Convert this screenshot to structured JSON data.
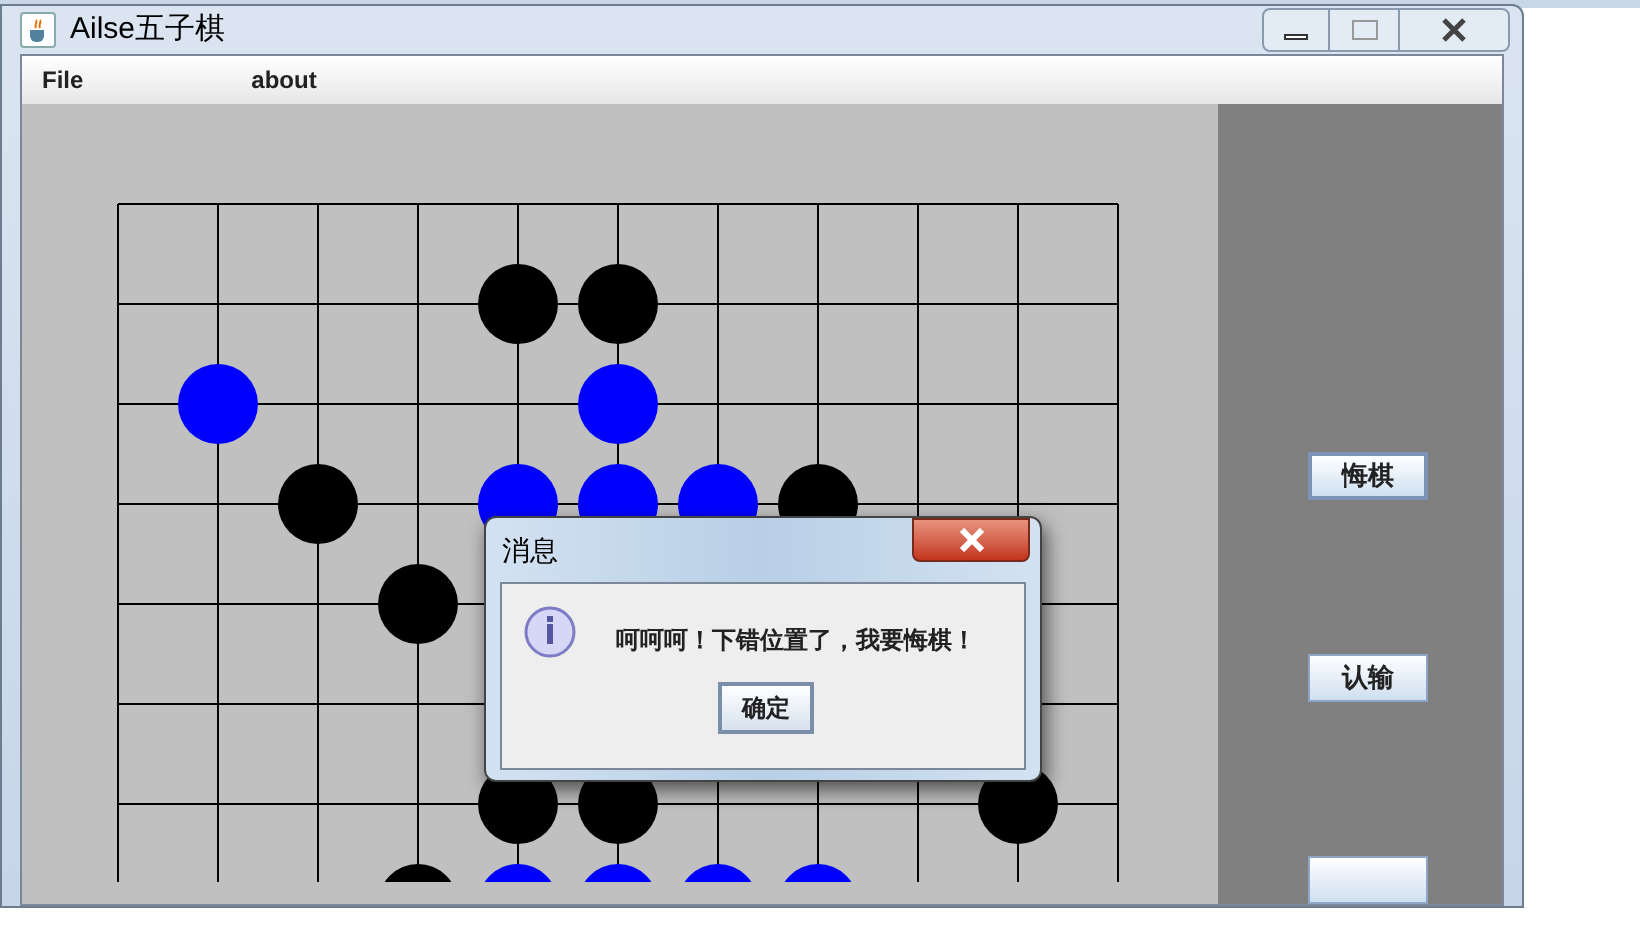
{
  "window": {
    "title": "Ailse五子棋"
  },
  "menu": [
    {
      "label": "File"
    },
    {
      "label": "about"
    }
  ],
  "board": {
    "rows": [
      {
        "cells": [
          {
            "kind": "empty"
          },
          {
            "kind": "empty"
          },
          {
            "kind": "empty"
          },
          {
            "kind": "empty"
          },
          {
            "kind": "empty"
          },
          {
            "kind": "empty"
          },
          {
            "kind": "empty"
          },
          {
            "kind": "empty"
          },
          {
            "kind": "empty"
          },
          {
            "kind": "empty"
          },
          {
            "kind": "empty"
          }
        ]
      },
      {
        "cells": [
          {
            "kind": "empty"
          },
          {
            "kind": "empty"
          },
          {
            "kind": "empty"
          },
          {
            "kind": "empty"
          },
          {
            "kind": "black"
          },
          {
            "kind": "black"
          },
          {
            "kind": "empty"
          },
          {
            "kind": "empty"
          },
          {
            "kind": "empty"
          },
          {
            "kind": "empty"
          },
          {
            "kind": "empty"
          }
        ]
      },
      {
        "cells": [
          {
            "kind": "empty"
          },
          {
            "kind": "blue"
          },
          {
            "kind": "empty"
          },
          {
            "kind": "empty"
          },
          {
            "kind": "empty"
          },
          {
            "kind": "blue"
          },
          {
            "kind": "empty"
          },
          {
            "kind": "empty"
          },
          {
            "kind": "empty"
          },
          {
            "kind": "empty"
          },
          {
            "kind": "empty"
          }
        ]
      },
      {
        "cells": [
          {
            "kind": "empty"
          },
          {
            "kind": "empty"
          },
          {
            "kind": "black"
          },
          {
            "kind": "empty"
          },
          {
            "kind": "blue"
          },
          {
            "kind": "blue"
          },
          {
            "kind": "blue"
          },
          {
            "kind": "black"
          },
          {
            "kind": "empty"
          },
          {
            "kind": "empty"
          },
          {
            "kind": "empty"
          }
        ]
      },
      {
        "cells": [
          {
            "kind": "empty"
          },
          {
            "kind": "empty"
          },
          {
            "kind": "empty"
          },
          {
            "kind": "black"
          },
          {
            "kind": "empty"
          },
          {
            "kind": "empty"
          },
          {
            "kind": "empty"
          },
          {
            "kind": "empty"
          },
          {
            "kind": "empty"
          },
          {
            "kind": "empty"
          },
          {
            "kind": "empty"
          }
        ]
      },
      {
        "cells": [
          {
            "kind": "empty"
          },
          {
            "kind": "empty"
          },
          {
            "kind": "empty"
          },
          {
            "kind": "empty"
          },
          {
            "kind": "empty"
          },
          {
            "kind": "empty"
          },
          {
            "kind": "empty"
          },
          {
            "kind": "empty"
          },
          {
            "kind": "empty"
          },
          {
            "kind": "empty"
          },
          {
            "kind": "empty"
          }
        ]
      },
      {
        "cells": [
          {
            "kind": "empty"
          },
          {
            "kind": "empty"
          },
          {
            "kind": "empty"
          },
          {
            "kind": "empty"
          },
          {
            "kind": "black"
          },
          {
            "kind": "black"
          },
          {
            "kind": "empty"
          },
          {
            "kind": "empty"
          },
          {
            "kind": "empty"
          },
          {
            "kind": "black"
          },
          {
            "kind": "empty"
          }
        ]
      },
      {
        "cells": [
          {
            "kind": "empty"
          },
          {
            "kind": "empty"
          },
          {
            "kind": "empty"
          },
          {
            "kind": "black"
          },
          {
            "kind": "blue"
          },
          {
            "kind": "blue"
          },
          {
            "kind": "blue"
          },
          {
            "kind": "blue"
          },
          {
            "kind": "empty"
          },
          {
            "kind": "empty"
          },
          {
            "kind": "empty"
          }
        ]
      }
    ]
  },
  "side_buttons": [
    {
      "label": "悔棋",
      "focused": true
    },
    {
      "label": "认输",
      "focused": false
    },
    {
      "focused": false
    }
  ],
  "dialog": {
    "title": "消息",
    "message": "呵呵呵！下错位置了，我要悔棋！",
    "ok": "确定"
  }
}
